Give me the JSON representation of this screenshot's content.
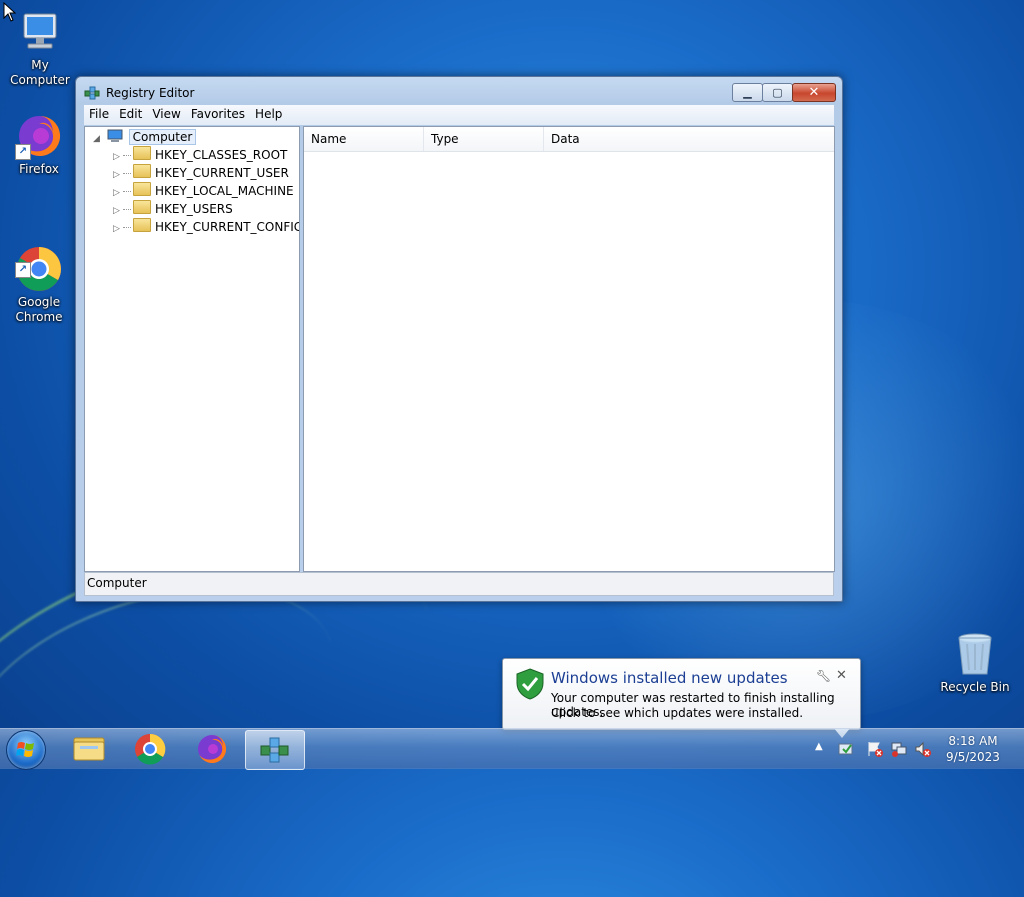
{
  "desktop": {
    "icons": [
      {
        "label": "My Computer"
      },
      {
        "label": "Firefox"
      },
      {
        "label": "Google\nChrome"
      },
      {
        "label": "Recycle Bin"
      }
    ]
  },
  "window": {
    "title": "Registry Editor",
    "menu": [
      "File",
      "Edit",
      "View",
      "Favorites",
      "Help"
    ],
    "tree": {
      "root": "Computer",
      "items": [
        "HKEY_CLASSES_ROOT",
        "HKEY_CURRENT_USER",
        "HKEY_LOCAL_MACHINE",
        "HKEY_USERS",
        "HKEY_CURRENT_CONFIG"
      ]
    },
    "list_columns": [
      "Name",
      "Type",
      "Data"
    ],
    "status": "Computer"
  },
  "notification": {
    "title": "Windows installed new updates",
    "line1": "Your computer was restarted to finish installing updates.",
    "line2": "Click to see which updates were installed."
  },
  "clock": {
    "time": "8:18 AM",
    "date": "9/5/2023"
  },
  "colors": {
    "accent": "#1c3f94",
    "desktop": "#1a6cc9"
  }
}
